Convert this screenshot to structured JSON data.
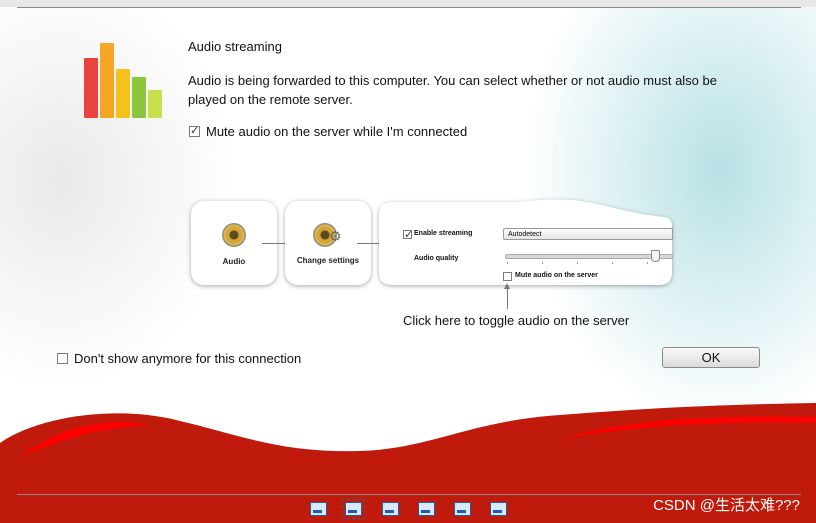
{
  "dialog": {
    "title": "Audio streaming",
    "description": "Audio is being forwarded to this computer. You can select whether or not audio must also be played on the remote server.",
    "mute_checkbox": {
      "label": "Mute audio on the server while I'm connected",
      "checked": true
    },
    "dont_show_checkbox": {
      "label": "Don't show anymore for this connection",
      "checked": false
    },
    "ok_label": "OK"
  },
  "logo": {
    "icon": "audio-bars-icon",
    "colors": [
      "#e8433f",
      "#f5a623",
      "#f4c21b",
      "#8cc63f",
      "#c7e04a"
    ]
  },
  "diagram": {
    "step_audio": "Audio",
    "step_settings": "Change settings",
    "enable_streaming_label": "Enable streaming",
    "audio_quality_label": "Audio quality",
    "quality_value": "Autodetect",
    "mute_server_label": "Mute audio on the server",
    "hint": "Click here to toggle audio on the server"
  },
  "toolbar": {
    "items": [
      "window-icon",
      "fullscreen-icon",
      "keyboard-icon",
      "fit-icon",
      "send-icon",
      "settings-icon"
    ],
    "selected": 1
  },
  "watermark": "CSDN @生活太难???",
  "colors": {
    "wave_red": "#c01a0c",
    "wave_bright": "#ff0000"
  }
}
